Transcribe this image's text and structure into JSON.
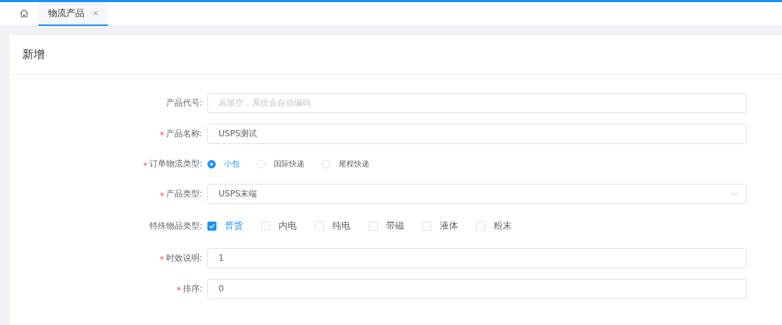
{
  "tabs": [
    {
      "kind": "home",
      "selected": false
    },
    {
      "kind": "page",
      "label": "物流产品",
      "selected": true,
      "closable": true
    }
  ],
  "card": {
    "title": "新增"
  },
  "form": [
    {
      "kind": "text",
      "label": "产品代号:",
      "required": false,
      "placeholder": "若留空，系统会自动编码"
    },
    {
      "kind": "text",
      "label": "产品名称:",
      "required": true,
      "value": "USPS测试"
    },
    {
      "kind": "radio",
      "label": "订单物流类型:",
      "required": true,
      "options": [
        {
          "label": "小包",
          "selected": true
        },
        {
          "label": "国际快递",
          "selected": false
        },
        {
          "label": "尾程快递",
          "selected": false
        }
      ]
    },
    {
      "kind": "select",
      "label": "产品类型:",
      "required": true,
      "value": "USPS末端"
    },
    {
      "kind": "checkbox",
      "label": "特殊物品类型:",
      "required": false,
      "options": [
        {
          "label": "普货",
          "checked": true
        },
        {
          "label": "内电",
          "checked": false
        },
        {
          "label": "纯电",
          "checked": false
        },
        {
          "label": "带磁",
          "checked": false
        },
        {
          "label": "液体",
          "checked": false
        },
        {
          "label": "粉末",
          "checked": false
        }
      ]
    },
    {
      "kind": "text",
      "label": "时效说明:",
      "required": true,
      "value": "1"
    },
    {
      "kind": "text",
      "label": "排序:",
      "required": true,
      "value": "0"
    }
  ]
}
